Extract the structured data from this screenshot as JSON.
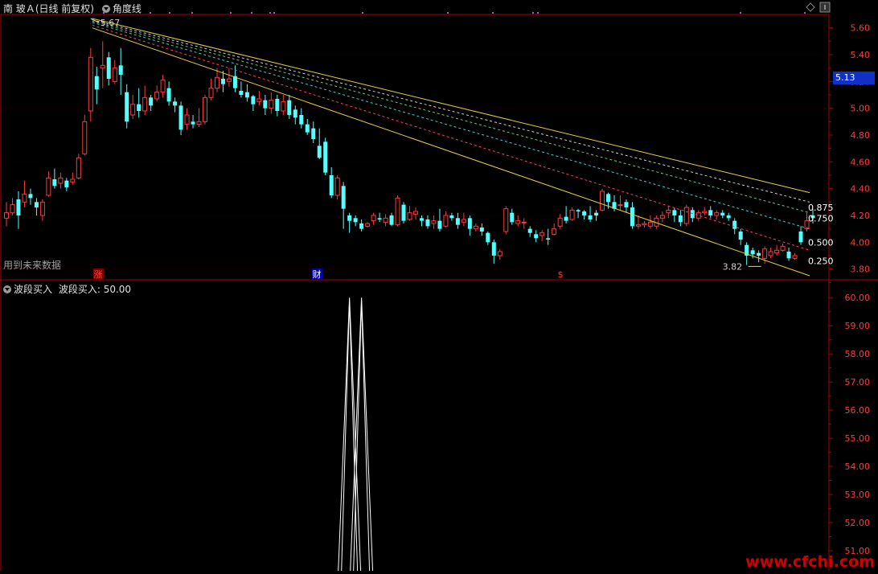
{
  "header": {
    "title": "南 玻Ａ(日线 前复权)",
    "indicator": "角度线"
  },
  "sub_header": {
    "name": "波段买入",
    "label": "波段买入: 50.00"
  },
  "future_data_note": "用到未来数据",
  "markers": [
    {
      "text": "涨",
      "color": "#ff4040",
      "bg": "#800000"
    },
    {
      "text": "财",
      "color": "#ffffff",
      "bg": "#0000b0"
    },
    {
      "text": "$",
      "color": "#ff4040",
      "bg": "#000000"
    }
  ],
  "current_price": "5.13",
  "watermark": "www.cfchi.com",
  "chart_data": [
    {
      "type": "candlestick",
      "title": "南 玻Ａ(日线 前复权)",
      "y_ticks": [
        "5.60",
        "5.40",
        "5.20",
        "5.00",
        "4.80",
        "4.60",
        "4.40",
        "4.20",
        "4.00",
        "3.80"
      ],
      "ylim": [
        3.72,
        5.7
      ],
      "high_label": "5.67",
      "low_label": "3.82",
      "fib_labels": [
        "0.875",
        "0.750",
        "0.500",
        "0.250"
      ],
      "candles": [
        [
          4.18,
          4.22,
          4.3,
          4.12
        ],
        [
          4.22,
          4.28,
          4.33,
          4.2
        ],
        [
          4.32,
          4.2,
          4.38,
          4.1
        ],
        [
          4.3,
          4.36,
          4.46,
          4.26
        ],
        [
          4.36,
          4.33,
          4.4,
          4.28
        ],
        [
          4.3,
          4.26,
          4.33,
          4.2
        ],
        [
          4.2,
          4.3,
          4.32,
          4.16
        ],
        [
          4.35,
          4.48,
          4.53,
          4.34
        ],
        [
          4.47,
          4.42,
          4.55,
          4.4
        ],
        [
          4.44,
          4.48,
          4.52,
          4.4
        ],
        [
          4.46,
          4.41,
          4.48,
          4.38
        ],
        [
          4.45,
          4.47,
          4.52,
          4.43
        ],
        [
          4.48,
          4.63,
          4.66,
          4.47
        ],
        [
          4.66,
          4.9,
          4.95,
          4.65
        ],
        [
          4.98,
          5.38,
          5.45,
          4.9
        ],
        [
          5.24,
          5.14,
          5.31,
          5.03
        ],
        [
          5.3,
          5.32,
          5.5,
          5.15
        ],
        [
          5.38,
          5.22,
          5.42,
          5.17
        ],
        [
          5.2,
          5.3,
          5.36,
          5.18
        ],
        [
          5.32,
          5.25,
          5.45,
          5.1
        ],
        [
          5.12,
          4.9,
          5.18,
          4.85
        ],
        [
          4.95,
          5.03,
          5.1,
          4.92
        ],
        [
          5.03,
          4.98,
          5.15,
          4.93
        ],
        [
          4.98,
          5.08,
          5.17,
          4.95
        ],
        [
          5.08,
          5.02,
          5.1,
          4.98
        ],
        [
          5.07,
          5.12,
          5.17,
          5.05
        ],
        [
          5.12,
          5.21,
          5.25,
          5.08
        ],
        [
          5.15,
          5.05,
          5.2,
          5.02
        ],
        [
          5.05,
          5.02,
          5.08,
          4.97
        ],
        [
          5.02,
          4.84,
          5.05,
          4.8
        ],
        [
          4.88,
          4.95,
          5.0,
          4.84
        ],
        [
          4.9,
          4.88,
          4.95,
          4.85
        ],
        [
          4.88,
          4.9,
          5.0,
          4.86
        ],
        [
          4.9,
          5.08,
          5.1,
          4.88
        ],
        [
          5.08,
          5.15,
          5.22,
          5.06
        ],
        [
          5.15,
          5.23,
          5.3,
          5.12
        ],
        [
          5.22,
          5.18,
          5.28,
          5.12
        ],
        [
          5.2,
          5.22,
          5.3,
          5.16
        ],
        [
          5.24,
          5.15,
          5.32,
          5.12
        ],
        [
          5.13,
          5.1,
          5.2,
          5.08
        ],
        [
          5.12,
          5.08,
          5.18,
          5.05
        ],
        [
          5.09,
          5.03,
          5.1,
          4.98
        ],
        [
          5.05,
          5.07,
          5.13,
          5.02
        ],
        [
          5.06,
          5.0,
          5.1,
          4.95
        ],
        [
          5.0,
          5.06,
          5.12,
          4.96
        ],
        [
          5.07,
          4.98,
          5.1,
          4.94
        ],
        [
          4.98,
          5.05,
          5.1,
          4.95
        ],
        [
          5.06,
          4.95,
          5.1,
          4.92
        ],
        [
          4.99,
          4.93,
          5.02,
          4.88
        ],
        [
          4.95,
          4.88,
          5.0,
          4.85
        ],
        [
          4.88,
          4.82,
          4.92,
          4.8
        ],
        [
          4.85,
          4.77,
          4.9,
          4.74
        ],
        [
          4.72,
          4.63,
          4.85,
          4.62
        ],
        [
          4.75,
          4.52,
          4.78,
          4.5
        ],
        [
          4.5,
          4.35,
          4.56,
          4.33
        ],
        [
          4.35,
          4.48,
          4.5,
          4.32
        ],
        [
          4.42,
          4.25,
          4.45,
          4.1
        ],
        [
          4.2,
          4.16,
          4.22,
          4.07
        ],
        [
          4.18,
          4.15,
          4.2,
          4.12
        ],
        [
          4.14,
          4.1,
          4.17,
          4.08
        ],
        [
          4.12,
          4.14,
          4.15,
          4.11
        ],
        [
          4.16,
          4.2,
          4.22,
          4.13
        ],
        [
          4.18,
          4.17,
          4.22,
          4.15
        ],
        [
          4.15,
          4.18,
          4.21,
          4.12
        ],
        [
          4.2,
          4.13,
          4.22,
          4.12
        ],
        [
          4.13,
          4.33,
          4.35,
          4.12
        ],
        [
          4.28,
          4.16,
          4.3,
          4.14
        ],
        [
          4.17,
          4.22,
          4.27,
          4.16
        ],
        [
          4.21,
          4.23,
          4.26,
          4.17
        ],
        [
          4.18,
          4.16,
          4.2,
          4.12
        ],
        [
          4.17,
          4.12,
          4.2,
          4.1
        ],
        [
          4.14,
          4.16,
          4.2,
          4.1
        ],
        [
          4.16,
          4.1,
          4.25,
          4.08
        ],
        [
          4.12,
          4.2,
          4.23,
          4.11
        ],
        [
          4.2,
          4.18,
          4.22,
          4.16
        ],
        [
          4.18,
          4.13,
          4.22,
          4.1
        ],
        [
          4.15,
          4.17,
          4.22,
          4.12
        ],
        [
          4.18,
          4.1,
          4.2,
          4.05
        ],
        [
          4.1,
          4.12,
          4.14,
          4.08
        ],
        [
          4.11,
          4.08,
          4.14,
          4.05
        ],
        [
          4.07,
          4.0,
          4.08,
          3.98
        ],
        [
          4.0,
          3.9,
          4.02,
          3.84
        ],
        [
          3.9,
          3.93,
          3.95,
          3.87
        ],
        [
          4.08,
          4.25,
          4.27,
          4.06
        ],
        [
          4.22,
          4.15,
          4.25,
          4.13
        ],
        [
          4.14,
          4.16,
          4.2,
          4.12
        ],
        [
          4.15,
          4.15,
          4.18,
          4.1
        ],
        [
          4.1,
          4.07,
          4.12,
          4.04
        ],
        [
          4.06,
          4.03,
          4.09,
          4.0
        ],
        [
          4.05,
          4.07,
          4.09,
          4.01
        ],
        [
          4.03,
          4.02,
          4.1,
          3.98
        ],
        [
          4.06,
          4.1,
          4.14,
          4.05
        ],
        [
          4.12,
          4.18,
          4.21,
          4.1
        ],
        [
          4.19,
          4.16,
          4.27,
          4.14
        ],
        [
          4.17,
          4.24,
          4.26,
          4.16
        ],
        [
          4.24,
          4.23,
          4.25,
          4.18
        ],
        [
          4.23,
          4.2,
          4.24,
          4.17
        ],
        [
          4.2,
          4.17,
          4.27,
          4.15
        ],
        [
          4.22,
          4.2,
          4.24,
          4.16
        ],
        [
          4.24,
          4.38,
          4.4,
          4.23
        ],
        [
          4.36,
          4.3,
          4.37,
          4.25
        ],
        [
          4.3,
          4.25,
          4.35,
          4.23
        ],
        [
          4.28,
          4.28,
          4.35,
          4.24
        ],
        [
          4.3,
          4.26,
          4.32,
          4.22
        ],
        [
          4.26,
          4.12,
          4.3,
          4.1
        ],
        [
          4.12,
          4.13,
          4.2,
          4.1
        ],
        [
          4.13,
          4.14,
          4.16,
          4.11
        ],
        [
          4.12,
          4.15,
          4.2,
          4.1
        ],
        [
          4.12,
          4.18,
          4.2,
          4.1
        ],
        [
          4.18,
          4.2,
          4.23,
          4.15
        ],
        [
          4.22,
          4.24,
          4.27,
          4.18
        ],
        [
          4.24,
          4.2,
          4.26,
          4.15
        ],
        [
          4.2,
          4.15,
          4.24,
          4.12
        ],
        [
          4.14,
          4.26,
          4.28,
          4.12
        ],
        [
          4.24,
          4.18,
          4.26,
          4.15
        ],
        [
          4.18,
          4.22,
          4.24,
          4.16
        ],
        [
          4.22,
          4.23,
          4.26,
          4.2
        ],
        [
          4.24,
          4.2,
          4.27,
          4.18
        ],
        [
          4.2,
          4.22,
          4.24,
          4.17
        ],
        [
          4.22,
          4.2,
          4.24,
          4.18
        ],
        [
          4.2,
          4.18,
          4.22,
          4.16
        ],
        [
          4.16,
          4.1,
          4.18,
          4.06
        ],
        [
          4.08,
          4.02,
          4.1,
          3.98
        ],
        [
          3.98,
          3.9,
          4.0,
          3.83
        ],
        [
          3.94,
          3.91,
          3.96,
          3.88
        ],
        [
          3.92,
          3.9,
          3.94,
          3.85
        ],
        [
          3.88,
          3.95,
          3.97,
          3.84
        ],
        [
          3.9,
          3.93,
          3.96,
          3.88
        ],
        [
          3.92,
          3.94,
          3.98,
          3.9
        ],
        [
          3.94,
          3.97,
          3.99,
          3.93
        ],
        [
          3.93,
          3.88,
          3.96,
          3.86
        ],
        [
          3.88,
          3.9,
          3.92,
          3.87
        ],
        [
          4.08,
          4.0,
          4.12,
          3.98
        ],
        [
          4.1,
          4.16,
          4.22,
          4.08
        ],
        [
          4.2,
          4.18,
          4.25,
          4.14
        ]
      ],
      "overlay_lines": [
        {
          "name": "top",
          "color": "#e8d040",
          "from": [
            5.67
          ],
          "to": [
            4.37
          ]
        },
        {
          "name": "fib-0.875",
          "color": "#d0d0d0",
          "from": [
            5.66
          ],
          "to": [
            4.3
          ],
          "dashed": true
        },
        {
          "name": "fib-0.750",
          "color": "#70c870",
          "from": [
            5.65
          ],
          "to": [
            4.22
          ],
          "dashed": true
        },
        {
          "name": "fib-0.500",
          "color": "#40d0d0",
          "from": [
            5.64
          ],
          "to": [
            4.1
          ],
          "dashed": true
        },
        {
          "name": "fib-0.250",
          "color": "#ff4060",
          "from": [
            5.62
          ],
          "to": [
            3.94
          ],
          "dashed": true
        },
        {
          "name": "bottom",
          "color": "#e8d040",
          "from": [
            5.6
          ],
          "to": [
            3.75
          ]
        }
      ]
    },
    {
      "type": "line",
      "title": "波段买入",
      "y_ticks": [
        "60.00",
        "59.00",
        "58.00",
        "57.00",
        "56.00",
        "55.00",
        "54.00",
        "53.00",
        "52.00",
        "51.00"
      ],
      "ylim": [
        50.0,
        60.35
      ],
      "spikes": [
        57,
        59
      ],
      "baseline": 50.0,
      "peak": 60.0
    }
  ]
}
